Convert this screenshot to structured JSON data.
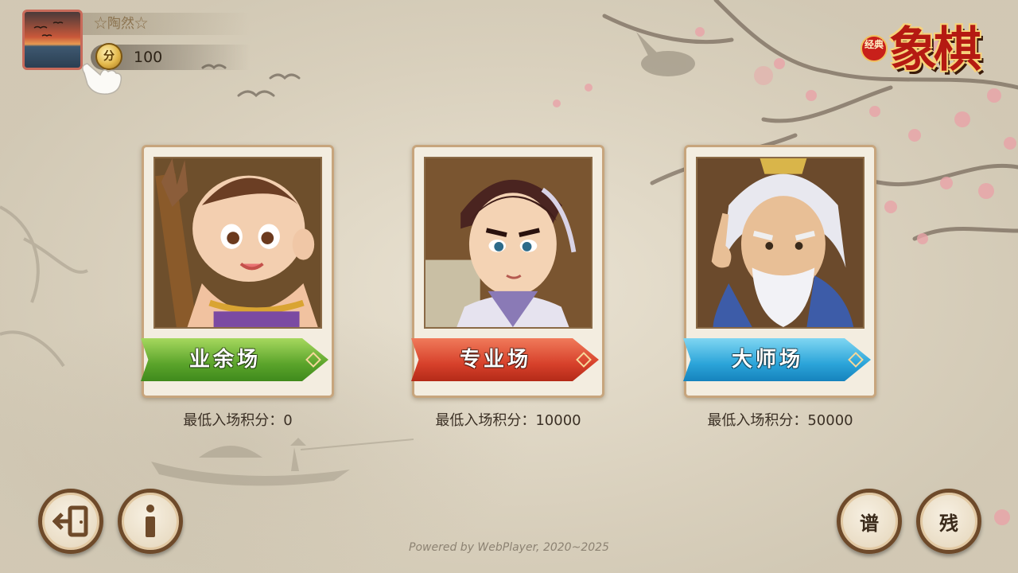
{
  "player": {
    "name": "☆陶然☆",
    "points_icon": "分",
    "points": "100"
  },
  "logo": {
    "badge": "经典",
    "title": "象棋"
  },
  "rooms": [
    {
      "label": "业余场",
      "min_score_text": "最低入场积分：0",
      "color": "green"
    },
    {
      "label": "专业场",
      "min_score_text": "最低入场积分：10000",
      "color": "red"
    },
    {
      "label": "大师场",
      "min_score_text": "最低入场积分：50000",
      "color": "blue"
    }
  ],
  "buttons": {
    "manual": "谱",
    "endgame": "残"
  },
  "footer": "Powered by  WebPlayer, 2020~2025",
  "icons": [
    "exit-icon",
    "info-icon",
    "coin-icon",
    "hand-pointer-icon"
  ],
  "colors": {
    "background": "#dcd3bf",
    "accent_brown": "#6e4a2a",
    "logo_red": "#b51a12"
  }
}
